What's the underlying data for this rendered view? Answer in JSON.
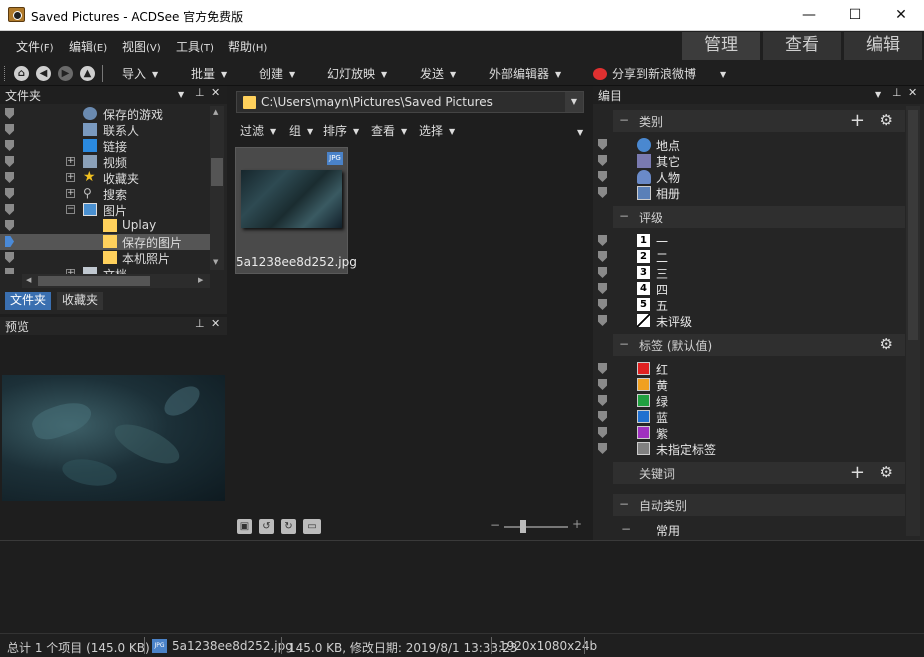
{
  "window": {
    "title": "Saved Pictures - ACDSee 官方免费版",
    "minimize": "—",
    "maximize": "☐",
    "close": "✕"
  },
  "menu": {
    "items": [
      {
        "label": "文件",
        "key": "(F)"
      },
      {
        "label": "编辑",
        "key": "(E)"
      },
      {
        "label": "视图",
        "key": "(V)"
      },
      {
        "label": "工具",
        "key": "(T)"
      },
      {
        "label": "帮助",
        "key": "(H)"
      }
    ],
    "modes": [
      "管理",
      "查看",
      "编辑"
    ]
  },
  "toolbar": {
    "items": [
      "导入",
      "批量",
      "创建",
      "幻灯放映",
      "发送",
      "外部编辑器"
    ],
    "weibo": "分享到新浪微博"
  },
  "folders_panel": {
    "title": "文件夹",
    "tree": [
      {
        "label": "保存的游戏"
      },
      {
        "label": "联系人"
      },
      {
        "label": "链接"
      },
      {
        "label": "视频",
        "expand": "+"
      },
      {
        "label": "收藏夹",
        "expand": "+"
      },
      {
        "label": "搜索",
        "expand": "+"
      },
      {
        "label": "图片",
        "expand": "−"
      },
      {
        "label": "Uplay"
      },
      {
        "label": "保存的图片"
      },
      {
        "label": "本机照片"
      },
      {
        "label": "文档"
      }
    ],
    "tabs": [
      "文件夹",
      "收藏夹"
    ]
  },
  "preview_panel": {
    "title": "预览"
  },
  "browser": {
    "path": "C:\\Users\\mayn\\Pictures\\Saved Pictures",
    "filters": [
      "过滤",
      "组",
      "排序",
      "查看",
      "选择"
    ],
    "file": {
      "name": "5a1238ee8d252.jpg",
      "badge": "JPG"
    }
  },
  "catalog_panel": {
    "title": "编目",
    "categories_title": "类别",
    "categories": [
      "地点",
      "其它",
      "人物",
      "相册"
    ],
    "ratings_title": "评级",
    "ratings": [
      {
        "num": "1",
        "label": "一"
      },
      {
        "num": "2",
        "label": "二"
      },
      {
        "num": "3",
        "label": "三"
      },
      {
        "num": "4",
        "label": "四"
      },
      {
        "num": "5",
        "label": "五"
      },
      {
        "num": "",
        "label": "未评级"
      }
    ],
    "labels_title": "标签 (默认值)",
    "labels": [
      {
        "label": "红",
        "color": "#e02020"
      },
      {
        "label": "黄",
        "color": "#f0a020"
      },
      {
        "label": "绿",
        "color": "#20a040"
      },
      {
        "label": "蓝",
        "color": "#2070d0"
      },
      {
        "label": "紫",
        "color": "#a030c0"
      },
      {
        "label": "未指定标签",
        "color": "#808080"
      }
    ],
    "keywords_title": "关键词",
    "auto_title": "自动类别",
    "auto_item": "常用"
  },
  "status": {
    "total": "总计 1 个项目 (145.0 KB)",
    "file": "5a1238ee8d252.jpg",
    "info": "145.0 KB, 修改日期: 2019/8/1 13:33:23",
    "dims": "1920x1080x24b"
  }
}
